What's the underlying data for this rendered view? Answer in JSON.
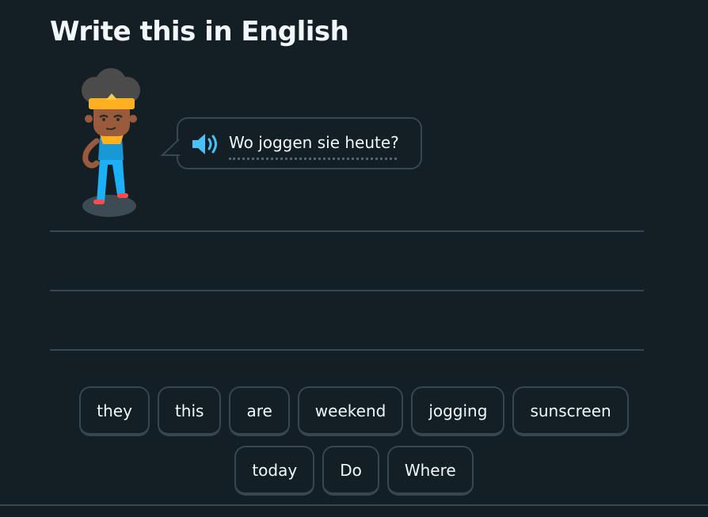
{
  "header": {
    "title": "Write this in English"
  },
  "prompt": {
    "text": "Wo joggen sie heute?",
    "speaker_icon": "speaker-icon"
  },
  "word_bank": {
    "row1": [
      "they",
      "this",
      "are",
      "weekend",
      "jogging",
      "sunscreen"
    ],
    "row2": [
      "today",
      "Do",
      "Where"
    ]
  },
  "colors": {
    "background": "#131f24",
    "border": "#37464f",
    "text": "#f1f7fb",
    "speaker": "#49c0f8"
  }
}
